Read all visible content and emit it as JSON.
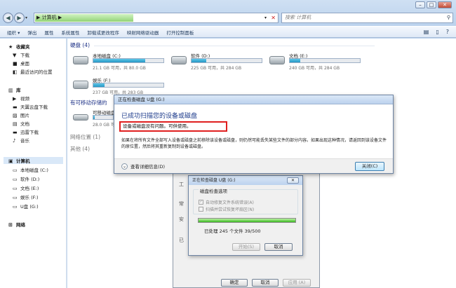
{
  "window": {
    "controls": [
      "–",
      "□",
      "✕"
    ]
  },
  "nav": {
    "back_icon": "◀",
    "forward_icon": "▶",
    "address": "▶ 计算机 ▶",
    "search_placeholder": "搜索 计算机"
  },
  "toolbar": {
    "items": [
      "组织 ▾",
      "弹出",
      "属性",
      "系统属性",
      "卸载或更改程序",
      "映射网络驱动器",
      "打开控制面板"
    ]
  },
  "sidebar": {
    "favorites": "收藏夹",
    "fav_items": [
      "下载",
      "桌面",
      "最近访问的位置"
    ],
    "library": "库",
    "lib_items": [
      "视频",
      "天翼云盘下载",
      "图片",
      "文档",
      "迅雷下载",
      "音乐"
    ],
    "computer": "计算机",
    "comp_items": [
      "本地磁盘 (C:)",
      "软件 (D:)",
      "文档 (E:)",
      "娱乐 (F:)",
      "U盘 (G:)"
    ],
    "network": "网络"
  },
  "main": {
    "hdd_header": "硬盘 (4)",
    "drives": [
      {
        "name": "本地磁盘 (C:)",
        "size": "21.1 GB 可用，共 80.0 GB",
        "used": 0.74
      },
      {
        "name": "软件 (D:)",
        "size": "225 GB 可用，共 284 GB",
        "used": 0.21
      },
      {
        "name": "文档 (E:)",
        "size": "240 GB 可用，共 284 GB",
        "used": 0.15
      },
      {
        "name": "娱乐 (F:)",
        "size": "237 GB 可用，共 283 GB",
        "used": 0.16
      }
    ],
    "removable_header": "有可移动存储的",
    "removable_drive": {
      "name": "可移动磁盘",
      "size": "28.0 GB 可用"
    },
    "network_header": "网络位置 (1)",
    "other_header": "其他 (4)"
  },
  "props": {
    "btn_ok": "确定",
    "btn_cancel": "取消",
    "btn_apply": "应用 (A)",
    "side_labels": [
      "工",
      "常",
      "安",
      "已"
    ]
  },
  "dlg1": {
    "title": "正在检查磁盘 U盘 (G:)",
    "header": "已成功扫描您的设备或磁盘",
    "status": "设备或磁盘没有问题。可供使用。",
    "desc": "如果在将所有文件全部写入设备或磁盘之前移除该设备或磁盘，则仍然可能丢失某些文件的部分内容。如果出现这种情况，请返回到该设备文件的原位置，然后将其重新复制到设备或磁盘。",
    "expand": "查看详细信息(D)",
    "close": "关闭(C)"
  },
  "dlg2": {
    "title": "正在检查磁盘 U盘 (G:)",
    "group_title": "磁盘检查选项",
    "opt1": "自动修复文件系统错误(A)",
    "opt2": "扫描并尝试恢复坏扇区(N)",
    "processed": "已处理 245 个文件 39/500",
    "start": "开始(S)",
    "cancel": "取消"
  }
}
